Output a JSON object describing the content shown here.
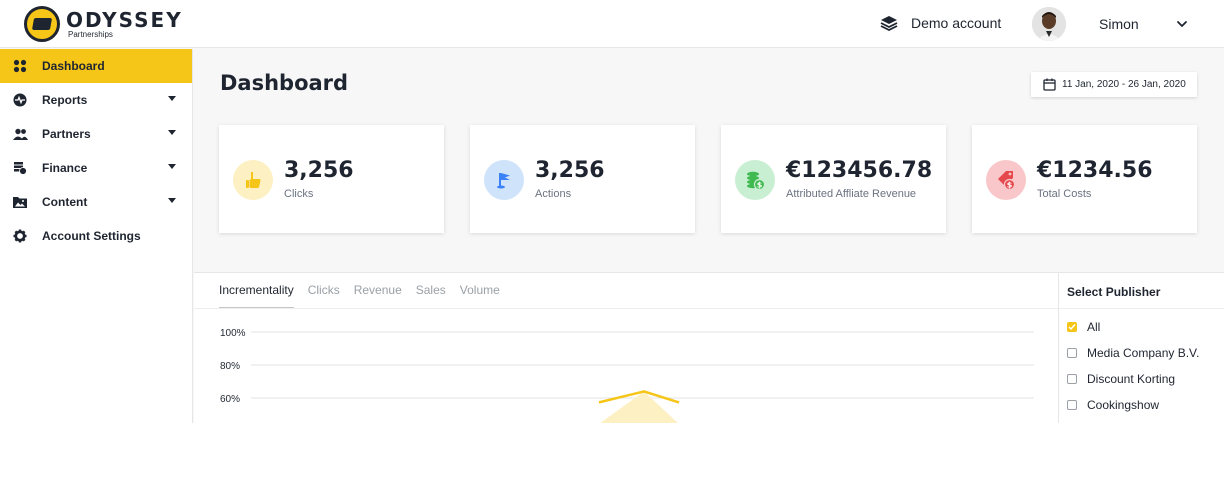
{
  "header": {
    "logo": {
      "name": "ODYSSEY",
      "sub": "Partnerships"
    },
    "account": {
      "label": "Demo account",
      "icon": "layers-icon"
    },
    "user": {
      "name": "Simon",
      "icon": "chevron-down-icon"
    }
  },
  "sidebar": {
    "items": [
      {
        "label": "Dashboard",
        "icon": "dashboard-grid-icon",
        "active": true,
        "has_children": false
      },
      {
        "label": "Reports",
        "icon": "pulse-icon",
        "active": false,
        "has_children": true
      },
      {
        "label": "Partners",
        "icon": "users-icon",
        "active": false,
        "has_children": true
      },
      {
        "label": "Finance",
        "icon": "finance-icon",
        "active": false,
        "has_children": true
      },
      {
        "label": "Content",
        "icon": "folder-image-icon",
        "active": false,
        "has_children": true
      },
      {
        "label": "Account Settings",
        "icon": "gear-icon",
        "active": false,
        "has_children": false
      }
    ]
  },
  "main": {
    "title": "Dashboard",
    "date_range": "11 Jan, 2020 - 26 Jan, 2020",
    "stats": [
      {
        "value": "3,256",
        "label": "Clicks",
        "icon": "thumbs-up-icon",
        "color": "#f5c518",
        "bg": "#fdf0c2"
      },
      {
        "value": "3,256",
        "label": "Actions",
        "icon": "flag-icon",
        "color": "#3b82f6",
        "bg": "#cfe3fb"
      },
      {
        "value": "€123456.78",
        "label": "Attributed Affliate Revenue",
        "icon": "money-stack-icon",
        "color": "#3fb950",
        "bg": "#c9efd3"
      },
      {
        "value": "€1234.56",
        "label": "Total Costs",
        "icon": "price-tag-icon",
        "color": "#e5484d",
        "bg": "#f9c7c9"
      }
    ],
    "tabs": [
      {
        "label": "Incrementality",
        "active": true
      },
      {
        "label": "Clicks",
        "active": false
      },
      {
        "label": "Revenue",
        "active": false
      },
      {
        "label": "Sales",
        "active": false
      },
      {
        "label": "Volume",
        "active": false
      }
    ]
  },
  "chart_data": {
    "type": "area",
    "y_ticks": [
      "100%",
      "80%",
      "60%"
    ],
    "ylim": [
      0,
      100
    ],
    "series": [
      {
        "color": "#f5c518",
        "peak_value": 64
      }
    ]
  },
  "publishers": {
    "title": "Select Publisher",
    "items": [
      {
        "label": "All",
        "checked": true
      },
      {
        "label": "Media Company B.V.",
        "checked": false
      },
      {
        "label": "Discount Korting",
        "checked": false
      },
      {
        "label": "Cookingshow",
        "checked": false
      }
    ]
  },
  "colors": {
    "accent": "#f5c518",
    "text": "#1f2530",
    "muted": "#6b7280"
  }
}
